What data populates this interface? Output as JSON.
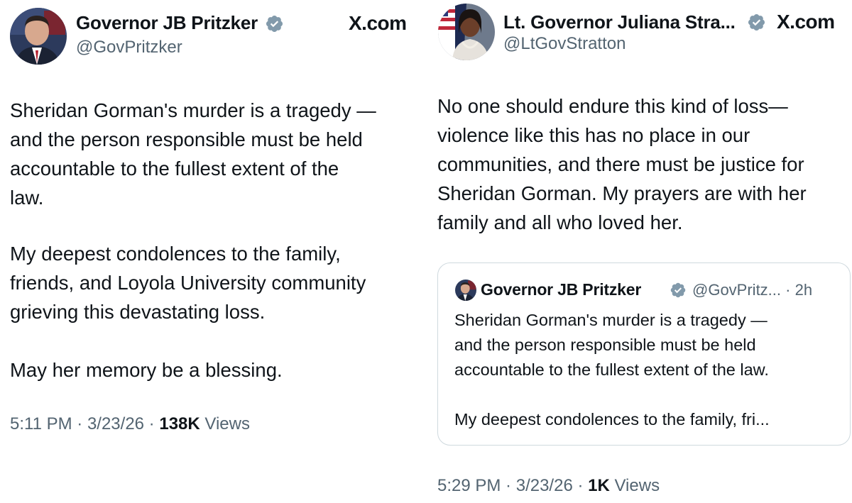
{
  "left_tweet": {
    "author_name": "Governor JB Pritzker",
    "handle": "@GovPritzker",
    "source_label": "X.com",
    "paragraph_lines": [
      [
        "Sheridan Gorman's murder is a tragedy —",
        "and the person responsible must be held",
        "accountable to the fullest extent of the",
        "law."
      ],
      [
        "My deepest condolences to the family,",
        "friends, and Loyola University community",
        "grieving this devastating loss."
      ],
      [
        "May her memory be a blessing."
      ]
    ],
    "time": "5:11 PM",
    "date": "3/23/26",
    "views_count": "138K",
    "views_label": "Views"
  },
  "right_tweet": {
    "author_name": "Lt. Governor Juliana Stra...",
    "handle": "@LtGovStratton",
    "source_label": "X.com",
    "body_lines": [
      "No one should endure this kind of loss—",
      "violence like this has no place in our",
      "communities, and there must be justice for",
      "Sheridan Gorman. My prayers are with her",
      "family and all who loved her."
    ],
    "time": "5:29 PM",
    "date": "3/23/26",
    "views_count": "1K",
    "views_label": "Views",
    "quoted_tweet": {
      "author_name": "Governor JB Pritzker",
      "handle": "@GovPritz...",
      "age": "2h",
      "paragraph_lines": [
        [
          "Sheridan Gorman's murder is a tragedy —",
          "and the person responsible must be held",
          "accountable to the fullest extent of the law."
        ],
        [
          "My deepest condolences to the family, fri..."
        ]
      ]
    }
  },
  "colors": {
    "text": "#0f1419",
    "secondary_text": "#536471",
    "verified_badge": "#829aab",
    "card_border": "#cfd9de"
  },
  "icons": [
    "verified-badge-icon",
    "x-logo-icon"
  ]
}
